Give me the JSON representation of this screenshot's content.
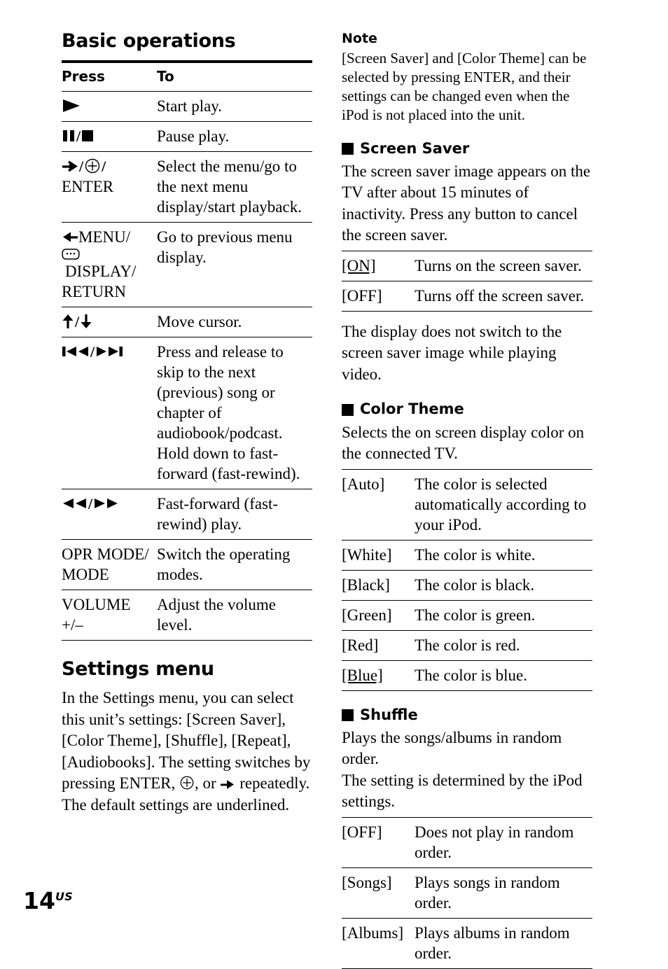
{
  "page": {
    "number": "14",
    "number_suffix": "US"
  },
  "left_column": {
    "title": "Basic operations",
    "table": {
      "headers": [
        "Press",
        "To"
      ],
      "rows": [
        {
          "key_icons": [
            "play"
          ],
          "key_text": "",
          "desc": "Start play."
        },
        {
          "key_icons": [
            "pause",
            "stop"
          ],
          "key_text": "",
          "desc": "Pause play."
        },
        {
          "key_icons": [
            "arrow-right",
            "enter-circle"
          ],
          "key_text": "ENTER",
          "desc": "Select the menu/go to the next menu display/start playback."
        },
        {
          "key_icons": [
            "arrow-left"
          ],
          "key_text": "MENU/",
          "key_text2": "DISPLAY/",
          "key_text3": "RETURN",
          "key_icons2": [
            "display-screen"
          ],
          "desc": "Go to previous menu display."
        },
        {
          "key_icons": [
            "arrow-up",
            "arrow-down"
          ],
          "key_text": "",
          "desc": "Move cursor."
        },
        {
          "key_icons": [
            "skip-prev",
            "skip-next"
          ],
          "key_text": "",
          "desc": "Press and release to skip to the next (previous) song or chapter of audiobook/podcast.\nHold down to fast-forward (fast-rewind)."
        },
        {
          "key_icons": [
            "rewind",
            "fast-forward"
          ],
          "key_text": "",
          "desc": "Fast-forward (fast-rewind) play."
        },
        {
          "key_icons": [],
          "key_text": "OPR MODE/ MODE",
          "desc": "Switch the operating modes."
        },
        {
          "key_icons": [],
          "key_text": "VOLUME +/–",
          "desc": "Adjust the volume level."
        }
      ]
    },
    "settings_menu": {
      "title": "Settings menu",
      "paragraph_part1": "In the Settings menu, you can select this unit’s settings: [Screen Saver], [Color Theme], [Shuffle], [Repeat], [Audiobooks]. The setting switches by pressing ENTER, ",
      "paragraph_part2": ", or ",
      "paragraph_part3": " repeatedly. The default settings are underlined."
    }
  },
  "right_column": {
    "note": {
      "heading": "Note",
      "body": "[Screen Saver] and [Color Theme] can be selected by pressing ENTER, and their settings can be changed even when the iPod is not placed into the unit."
    },
    "screen_saver": {
      "heading": "Screen Saver",
      "intro": "The screen saver image appears on the TV after about 15 minutes of inactivity. Press any button to cancel the screen saver.",
      "table": {
        "rows": [
          {
            "option": "[ON]",
            "default": true,
            "desc": "Turns on the screen saver."
          },
          {
            "option": "[OFF]",
            "default": false,
            "desc": "Turns off the screen saver."
          }
        ]
      },
      "after_table": "The display does not switch to the screen saver image while playing video."
    },
    "color_theme": {
      "heading": "Color Theme",
      "intro": "Selects the on screen display color on the connected TV.",
      "table": {
        "rows": [
          {
            "option": "[Auto]",
            "default": false,
            "desc": "The color is selected automatically according to your iPod."
          },
          {
            "option": "[White]",
            "default": false,
            "desc": "The color is white."
          },
          {
            "option": "[Black]",
            "default": false,
            "desc": "The color is black."
          },
          {
            "option": "[Green]",
            "default": false,
            "desc": "The color is green."
          },
          {
            "option": "[Red]",
            "default": false,
            "desc": "The color is red."
          },
          {
            "option": "[Blue]",
            "default": true,
            "desc": "The color is blue."
          }
        ]
      }
    },
    "shuffle": {
      "heading": "Shuffle",
      "intro": "Plays the songs/albums in random order.\nThe setting is determined by the iPod settings.",
      "table": {
        "rows": [
          {
            "option": "[OFF]",
            "default": false,
            "desc": "Does not play in random order."
          },
          {
            "option": "[Songs]",
            "default": false,
            "desc": "Plays songs in random order."
          },
          {
            "option": "[Albums]",
            "default": false,
            "desc": "Plays albums in random order."
          }
        ]
      }
    }
  }
}
